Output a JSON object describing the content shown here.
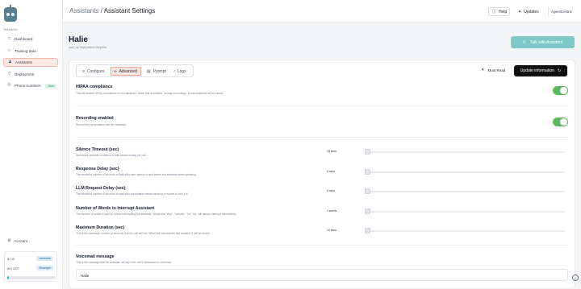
{
  "app": {
    "org_name": "AgentCentric"
  },
  "sidebar": {
    "section_label": "MANAGE",
    "items": [
      {
        "label": "Dashboard",
        "icon": "message-square-icon"
      },
      {
        "label": "Training data",
        "icon": "star-icon"
      },
      {
        "label": "Assistants",
        "icon": "users-icon",
        "active": true
      },
      {
        "label": "Deployment",
        "icon": "filter-icon"
      },
      {
        "label": "Phone numbers",
        "icon": "phone-icon",
        "badge": "Soon"
      }
    ],
    "account_label": "Account",
    "usage": {
      "assistants_count": "6 / 10",
      "assistants_tag": "Assistants",
      "messages_count": "83 / 2377",
      "messages_tag": "Messages",
      "progress_fraction": 0.035
    }
  },
  "topbar": {
    "breadcrumb_parent": "Assistants",
    "breadcrumb_sep": "/",
    "breadcrumb_current": "Assistant Settings",
    "help_label": "Help",
    "updates_label": "Updates"
  },
  "assistant": {
    "name": "Halie",
    "id": "asst_tqTXhjfQeHftJGWxjHHu",
    "talk_button": "Talk with Assistant"
  },
  "tabs": [
    {
      "label": "Configure",
      "icon": "sliders-icon"
    },
    {
      "label": "Advanced",
      "icon": "advanced-icon",
      "active": true
    },
    {
      "label": "Prompt",
      "icon": "document-icon"
    },
    {
      "label": "Logs",
      "icon": "wrench-icon"
    }
  ],
  "actions": {
    "must_read": "Must Read",
    "update": "Update information"
  },
  "toggles": [
    {
      "label": "HIPAA compliance",
      "desc": "This will enable HIPAA compliance for the assistant. When this is enabled, no logs, recordings, or transcriptions will be stored.",
      "on": true
    },
    {
      "label": "Recording enabled",
      "desc": "Record the conversation with the assistant.",
      "on": true
    }
  ],
  "sliders": [
    {
      "label": "Silence Timeout (sec)",
      "desc": "How many seconds of silence to wait before ending the call.",
      "value": "10 secs",
      "level": 0
    },
    {
      "label": "Response Delay (sec)",
      "desc": "The minimum number of seconds to wait after user speech to end before the assistant starts speaking.",
      "value": "0 secs",
      "level": 0
    },
    {
      "label": "LLM Request Delay (sec)",
      "desc": "The minimum number of seconds to wait after punctuation before sending a request to the LLM.",
      "value": "0 secs",
      "level": 0
    },
    {
      "label": "Number of Words to Interrupt Assistant",
      "desc": "The number of words to wait for before interrupting the assistant. Words like \"stop\", \"actually\", \"no\", etc. will always interrupt immediately.",
      "value": "1 words",
      "level": 0
    },
    {
      "label": "Maximum Duration (sec)",
      "desc": "This is the maximum number of seconds that the call will last. When the call reaches this duration, it will be ended.",
      "value": "10 secs",
      "level": 0
    }
  ],
  "voicemail": {
    "label": "Voicemail message",
    "desc": "This is the message that the assistant will say if the call is forwarded to voicemail.",
    "value": "Halie"
  }
}
